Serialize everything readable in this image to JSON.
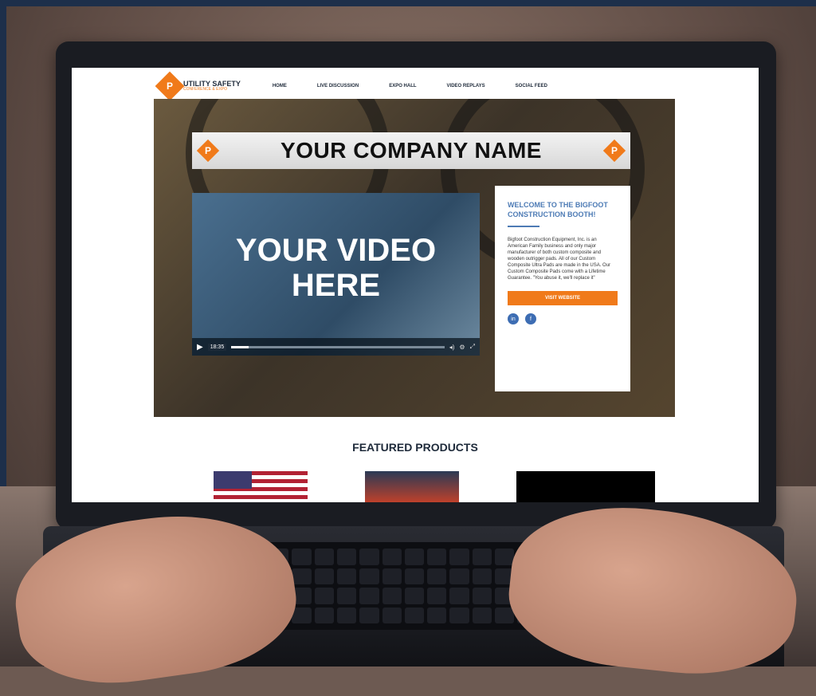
{
  "site": {
    "logo": {
      "mark": "P",
      "title": "UTILITY SAFETY",
      "subtitle": "CONFERENCE & EXPO"
    },
    "nav": [
      "HOME",
      "LIVE DISCUSSION",
      "EXPO HALL",
      "VIDEO REPLAYS",
      "SOCIAL FEED"
    ]
  },
  "hero": {
    "banner_title": "YOUR COMPANY NAME",
    "video": {
      "text_line1": "YOUR VIDEO",
      "text_line2": "HERE",
      "time": "18:35",
      "progress": 0.08
    },
    "card": {
      "title": "WELCOME TO THE BIGFOOT CONSTRUCTION BOOTH!",
      "body": "Bigfoot Construction Equipment, Inc. is an American Family business and only major manufacturer of both custom composite and wooden outrigger pads. All of our Custom Composite Ultra Pads are made in the USA. Our Custom Composite Pads come with a Lifetime Guarantee. \"You abuse it, we'll replace it\"",
      "button": "VISIT WEBSITE",
      "social": [
        "in",
        "f"
      ]
    }
  },
  "featured": {
    "title": "FEATURED PRODUCTS"
  },
  "colors": {
    "accent": "#f07a1a",
    "link": "#4d7bb5",
    "navy": "#1e2a3a"
  }
}
